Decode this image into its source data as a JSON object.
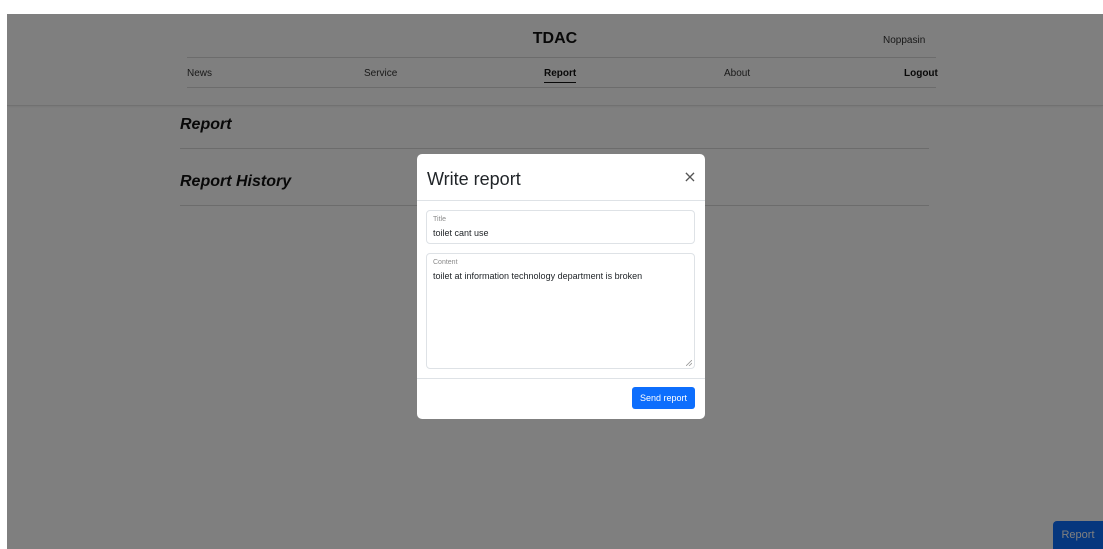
{
  "header": {
    "brand": "TDAC",
    "user_name": "Noppasin",
    "nav": [
      {
        "label": "News"
      },
      {
        "label": "Service"
      },
      {
        "label": "Report"
      },
      {
        "label": "About"
      }
    ],
    "logout_label": "Logout"
  },
  "page": {
    "report_heading": "Report",
    "history_heading": "Report History",
    "fab_label": "Report"
  },
  "modal": {
    "title": "Write report",
    "close_glyph": "×",
    "title_field": {
      "label": "Title",
      "value": "toilet cant use"
    },
    "content_field": {
      "label": "Content",
      "value": "toilet at information technology department is broken"
    },
    "send_label": "Send report"
  },
  "colors": {
    "primary": "#0d6efd",
    "backdrop": "rgba(0,0,0,0.5)"
  }
}
